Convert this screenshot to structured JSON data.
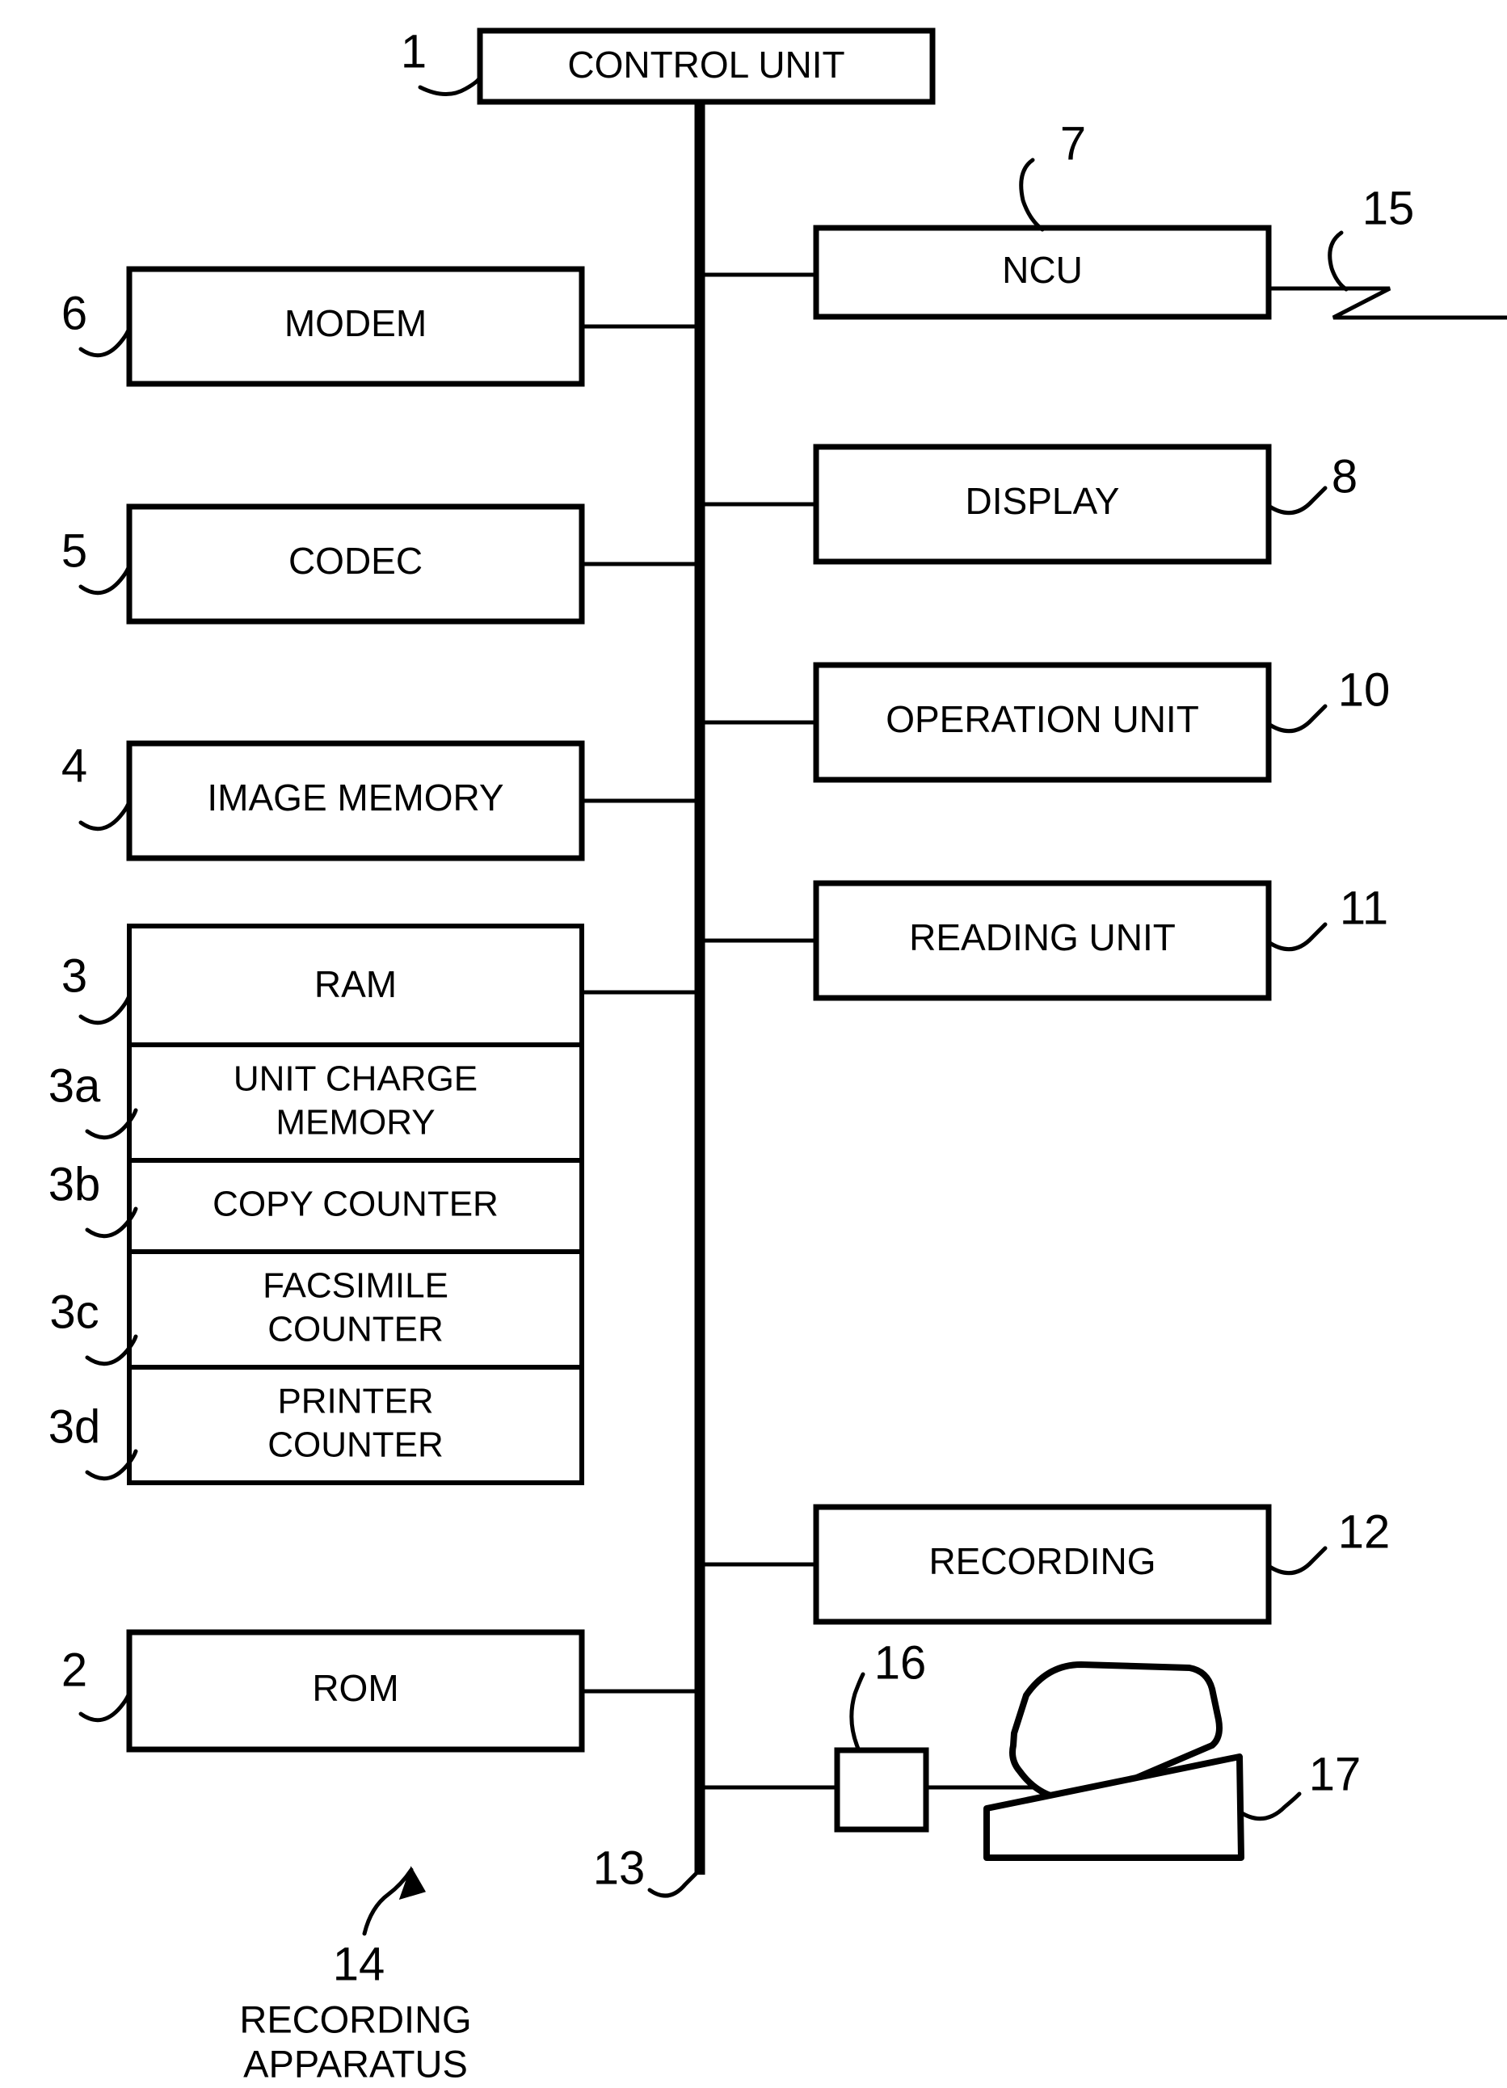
{
  "figure": {
    "title": "Facsimile / recording apparatus block diagram",
    "caption_line1": "RECORDING",
    "caption_line2": "APPARATUS",
    "caption_ref": "14",
    "bus_ref": "13"
  },
  "blocks": {
    "control_unit": {
      "label": "CONTROL UNIT",
      "ref": "1"
    },
    "modem": {
      "label": "MODEM",
      "ref": "6"
    },
    "codec": {
      "label": "CODEC",
      "ref": "5"
    },
    "image_memory": {
      "label": "IMAGE MEMORY",
      "ref": "4"
    },
    "rom": {
      "label": "ROM",
      "ref": "2"
    },
    "ncu": {
      "label": "NCU",
      "ref": "7"
    },
    "display": {
      "label": "DISPLAY",
      "ref": "8"
    },
    "operation_unit": {
      "label": "OPERATION UNIT",
      "ref": "10"
    },
    "reading_unit": {
      "label": "READING UNIT",
      "ref": "11"
    },
    "recording": {
      "label": "RECORDING",
      "ref": "12"
    }
  },
  "ram_stack": {
    "ref": "3",
    "rows": [
      {
        "ref": "3",
        "label_line1": "RAM",
        "label_line2": ""
      },
      {
        "ref": "3a",
        "label_line1": "UNIT CHARGE",
        "label_line2": "MEMORY"
      },
      {
        "ref": "3b",
        "label_line1": "COPY COUNTER",
        "label_line2": ""
      },
      {
        "ref": "3c",
        "label_line1": "FACSIMILE",
        "label_line2": "COUNTER"
      },
      {
        "ref": "3d",
        "label_line1": "PRINTER",
        "label_line2": "COUNTER"
      }
    ]
  },
  "peripherals": {
    "telephone_line": {
      "ref": "15"
    },
    "connector": {
      "ref": "16"
    },
    "handset": {
      "ref": "17"
    }
  },
  "colors": {
    "ink": "#000000",
    "paper": "#ffffff"
  }
}
